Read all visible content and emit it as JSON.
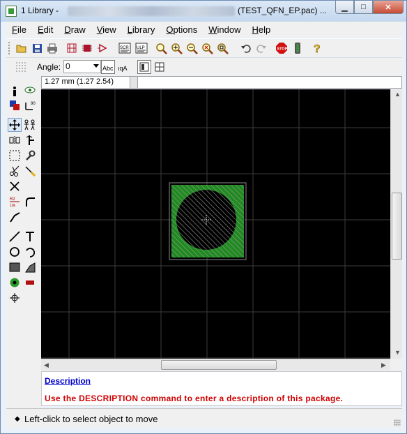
{
  "window": {
    "title_prefix": "1 Library - ",
    "title_suffix": "(TEST_QFN_EP.pac) ...",
    "minimize_symbol": "▁",
    "maximize_symbol": "□",
    "close_symbol": "✕"
  },
  "menu": {
    "items": [
      {
        "u": "F",
        "rest": "ile"
      },
      {
        "u": "E",
        "rest": "dit"
      },
      {
        "u": "D",
        "rest": "raw"
      },
      {
        "u": "V",
        "rest": "iew"
      },
      {
        "u": "L",
        "rest": "ibrary"
      },
      {
        "u": "O",
        "rest": "ptions"
      },
      {
        "u": "W",
        "rest": "indow"
      },
      {
        "u": "H",
        "rest": "elp"
      }
    ]
  },
  "toolbar": {
    "angle_label": "Angle:",
    "angle_value": "0",
    "stop_label": "STOP",
    "scr_label": "SCR",
    "ulp_label": "ULP",
    "help_symbol": "?"
  },
  "coord": {
    "text": "1.27 mm (1.27 2.54)"
  },
  "canvas": {
    "grid_color": "#3c3c3c",
    "pad_color": "#1f8a1f",
    "background": "#000000"
  },
  "description": {
    "heading": "Description",
    "message": "Use the DESCRIPTION command to enter a description of this package."
  },
  "status": {
    "text": "Left-click to select object to move",
    "icon": "diamond-icon"
  },
  "colors": {
    "accent": "#0000cc",
    "warning": "#d00000"
  }
}
